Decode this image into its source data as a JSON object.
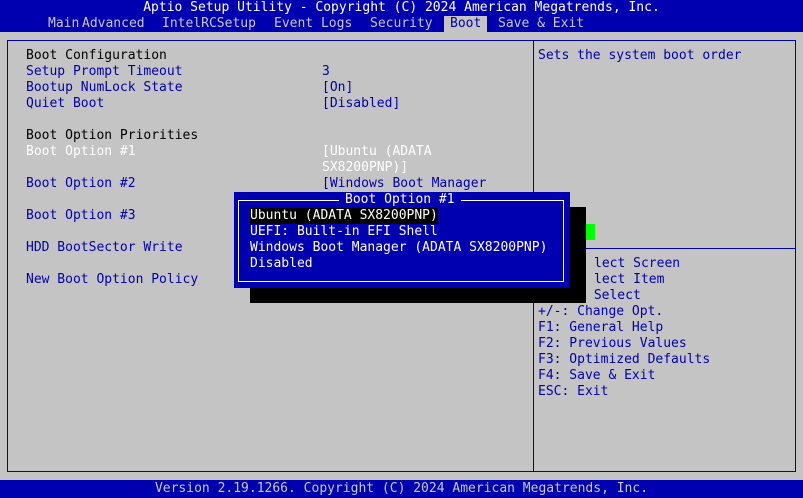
{
  "title": "Aptio Setup Utility - Copyright (C) 2024 American Megatrends, Inc.",
  "menu": {
    "items": [
      "Main",
      "Advanced",
      "IntelRCSetup",
      "Event Logs",
      "Security",
      "Boot",
      "Save & Exit"
    ],
    "active": "Boot"
  },
  "settings": {
    "boot_configuration": "Boot Configuration",
    "setup_prompt_timeout": {
      "label": "Setup Prompt Timeout",
      "value": "3"
    },
    "bootup_numlock_state": {
      "label": "Bootup NumLock State",
      "value": "[On]"
    },
    "quiet_boot": {
      "label": "Quiet Boot",
      "value": "[Disabled]"
    },
    "boot_option_priorities": "Boot Option Priorities",
    "boot_option_1": {
      "label": "Boot Option #1",
      "value_line1": "[Ubuntu (ADATA",
      "value_line2": "SX8200PNP)]"
    },
    "boot_option_2": {
      "label": "Boot Option #2",
      "value_line1": "[Windows Boot Manager"
    },
    "boot_option_3": {
      "label": "Boot Option #3"
    },
    "hdd_bootsector_write": {
      "label": "HDD BootSector Write"
    },
    "new_boot_option_policy": {
      "label": "New Boot Option Policy"
    }
  },
  "help": {
    "description": "Sets the system boot order",
    "keys": [
      "lect Screen",
      "lect Item",
      " Select",
      "+/-: Change Opt.",
      "F1: General Help",
      "F2: Previous Values",
      "F3: Optimized Defaults",
      "F4: Save & Exit",
      "ESC: Exit"
    ]
  },
  "popup": {
    "title": "Boot Option #1",
    "options": [
      "Ubuntu (ADATA SX8200PNP)",
      "UEFI: Built-in EFI Shell",
      "Windows Boot Manager (ADATA SX8200PNP)",
      "Disabled"
    ],
    "selected_index": 0
  },
  "footer": "Version 2.19.1266. Copyright (C) 2024 American Megatrends, Inc.",
  "colors": {
    "bios_blue": "#0000b0",
    "background_gray": "#c4c4c4",
    "cursor_green": "#00ff00"
  }
}
